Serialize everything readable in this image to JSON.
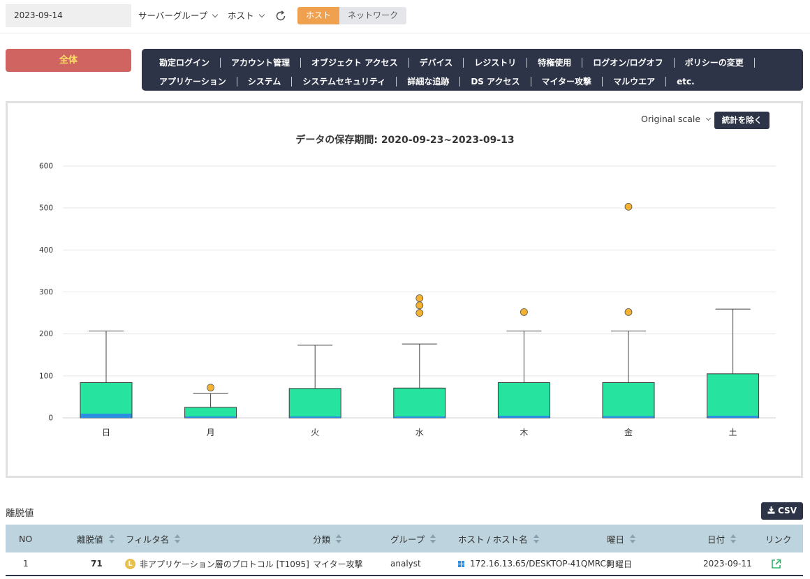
{
  "toolbar": {
    "date": "2023-09-14",
    "server_group_label": "サーバーグループ",
    "host_label": "ホスト",
    "toggle": [
      "ホスト",
      "ネットワーク"
    ]
  },
  "categories": {
    "all_label": "全体",
    "row1": [
      "勘定ログイン",
      "アカウント管理",
      "オブジェクト アクセス",
      "デバイス",
      "レジストリ",
      "特権使用",
      "ログオン/ログオフ",
      "ポリシーの変更"
    ],
    "row2": [
      "アプリケーション",
      "システム",
      "システムセキュリティ",
      "詳細な追跡",
      "DS アクセス",
      "マイター攻撃",
      "マルウエア",
      "etc."
    ]
  },
  "chart_controls": {
    "scale_label": "Original scale",
    "exclude_button": "統計を除く"
  },
  "chart_data": {
    "type": "boxplot",
    "title": "データの保存期間: 2020-09-23~2023-09-13",
    "categories": [
      "日",
      "月",
      "火",
      "水",
      "木",
      "金",
      "土"
    ],
    "ylim": [
      0,
      600
    ],
    "yticks": [
      0,
      100,
      200,
      300,
      400,
      500,
      600
    ],
    "grid": true,
    "box_color": "#27e3a0",
    "median_color": "#2b8ee0",
    "outlier_color": "#f4b233",
    "boxes": [
      {
        "min": 0,
        "q1": 0,
        "median": 10,
        "q3": 84,
        "max": 207,
        "outliers": []
      },
      {
        "min": 0,
        "q1": 0,
        "median": 2,
        "q3": 25,
        "max": 58,
        "outliers": [
          72
        ]
      },
      {
        "min": 0,
        "q1": 0,
        "median": 3,
        "q3": 70,
        "max": 173,
        "outliers": []
      },
      {
        "min": 0,
        "q1": 0,
        "median": 3,
        "q3": 71,
        "max": 176,
        "outliers": [
          250,
          268,
          285
        ]
      },
      {
        "min": 0,
        "q1": 0,
        "median": 5,
        "q3": 84,
        "max": 207,
        "outliers": [
          252
        ]
      },
      {
        "min": 0,
        "q1": 0,
        "median": 4,
        "q3": 84,
        "max": 207,
        "outliers": [
          252,
          503
        ]
      },
      {
        "min": 0,
        "q1": 0,
        "median": 5,
        "q3": 105,
        "max": 259,
        "outliers": []
      }
    ]
  },
  "outliers_section": {
    "title": "離脱値",
    "csv_label": "CSV",
    "columns": [
      "NO",
      "離脱値",
      "フィルタ名",
      "分類",
      "グループ",
      "ホスト / ホスト名",
      "曜日",
      "日付",
      "リンク"
    ],
    "rows": [
      {
        "no": "1",
        "value": "71",
        "level": "L",
        "filter": "非アプリケーション層のプロトコル [T1095]",
        "category": "マイター攻撃",
        "group": "analyst",
        "host": "172.16.13.65/DESKTOP-41QMRC8",
        "weekday": "月曜日",
        "date": "2023-09-11"
      }
    ]
  }
}
